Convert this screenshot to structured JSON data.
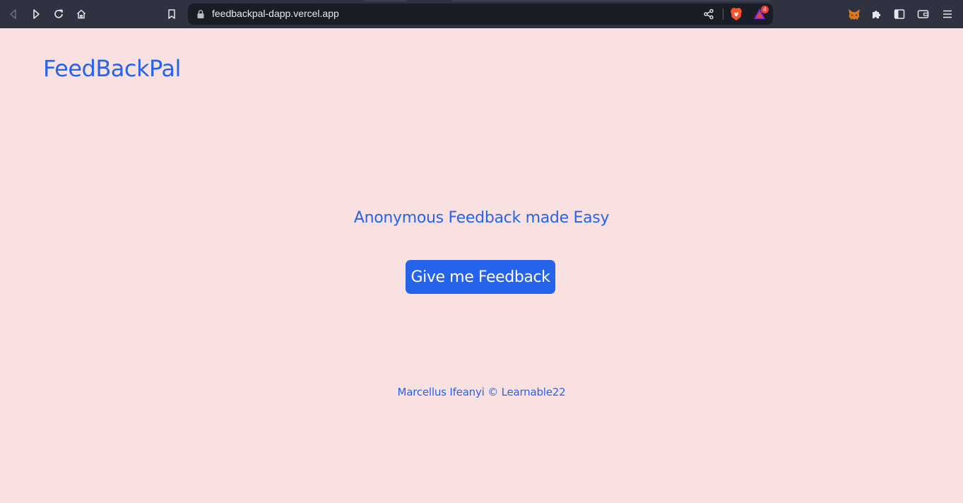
{
  "browser": {
    "url": "feedbackpal-dapp.vercel.app",
    "notification_count": "4",
    "icons": {
      "back": "back-icon",
      "forward": "forward-icon",
      "reload": "reload-icon",
      "home": "home-icon",
      "bookmark": "bookmark-icon",
      "lock": "lock-icon",
      "share": "share-icon",
      "brave_shields": "brave-lion-icon",
      "brave_rewards": "brave-rewards-icon",
      "metamask": "metamask-fox-icon",
      "extensions": "puzzle-icon",
      "sidebar": "sidebar-icon",
      "wallet": "wallet-icon",
      "menu": "hamburger-menu-icon"
    },
    "colors": {
      "toolbar": "#2f3240",
      "urlbar": "#1b1d26"
    }
  },
  "app": {
    "brand": "FeedBackPal",
    "tagline": "Anonymous Feedback made Easy",
    "cta_label": "Give me Feedback",
    "footer": "Marcellus Ifeanyi © Learnable22",
    "colors": {
      "background": "#f9e1e2",
      "accent": "#2563eb",
      "button_text": "#ffffff"
    }
  }
}
